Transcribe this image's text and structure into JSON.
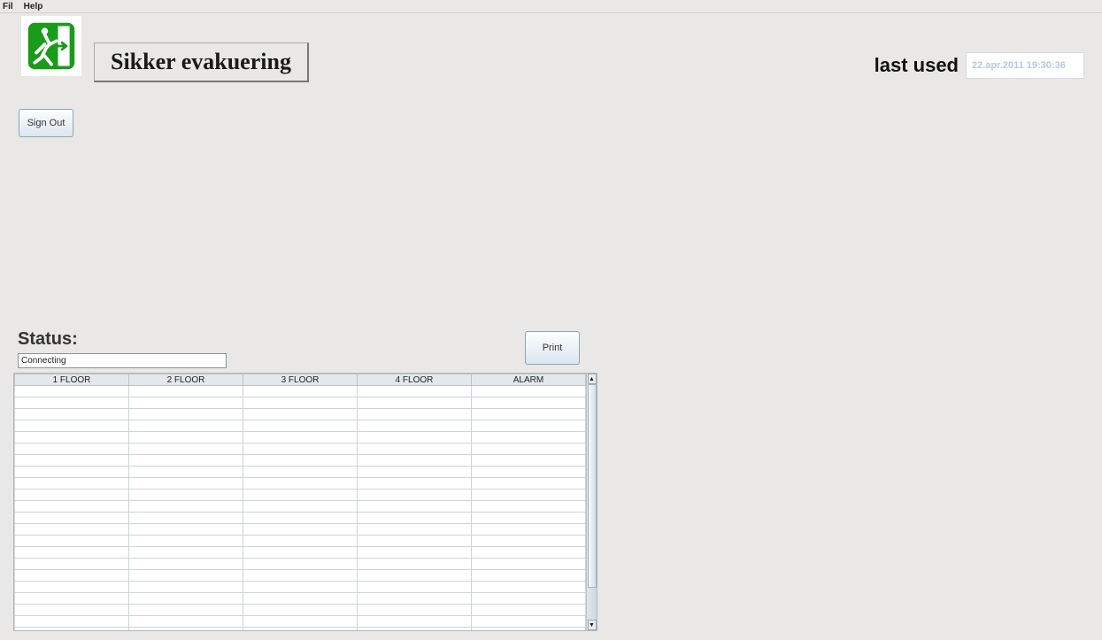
{
  "menu": {
    "items": [
      "Fil",
      "Help"
    ]
  },
  "header": {
    "title": "Sikker evakuering",
    "last_used_label": "last used",
    "last_used_value": "22.apr.2011 19:30:36"
  },
  "buttons": {
    "sign_out": "Sign Out",
    "print": "Print"
  },
  "status": {
    "label": "Status:",
    "value": "Connecting"
  },
  "table": {
    "columns": [
      "1 FLOOR",
      "2 FLOOR",
      "3 FLOOR",
      "4 FLOOR",
      "ALARM"
    ],
    "row_count": 22
  }
}
